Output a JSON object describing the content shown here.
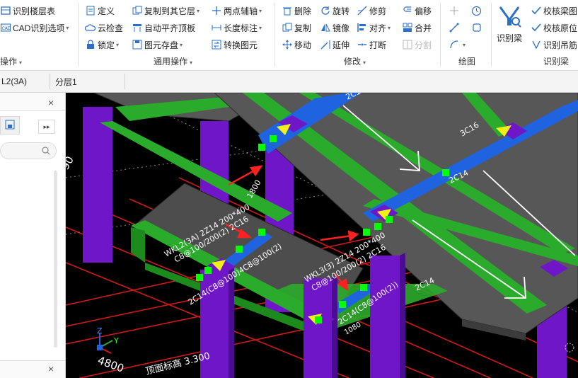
{
  "ribbon": {
    "col1": {
      "floor": "识别楼层表",
      "cad_options": "CAD识别选项",
      "group": "操作"
    },
    "col2": {
      "define": "定义",
      "cloud_check": "云检查",
      "lock": "锁定"
    },
    "col3": {
      "copy_to_floor": "复制到其它层",
      "auto_level": "自动平齐顶板",
      "save_elem": "图元存盘",
      "group": "通用操作"
    },
    "col4": {
      "two_point_axis": "两点辅轴",
      "length_label": "长度标注",
      "convert_elem": "转换图元"
    },
    "col5": {
      "delete": "删除",
      "copy": "复制",
      "move": "移动"
    },
    "col6": {
      "rotate": "旋转",
      "mirror": "镜像",
      "extend": "延伸"
    },
    "col7": {
      "trim": "修剪",
      "align": "对齐",
      "break": "打断",
      "group": "修改"
    },
    "col8": {
      "offset": "偏移",
      "merge": "合并",
      "split": "分割"
    },
    "draw": {
      "group": "绘图"
    },
    "recognize": {
      "identify_beam": "识别梁",
      "check_beam_drawing": "校核梁图",
      "check_origin": "校核原位",
      "identify_hanger": "识别吊筋",
      "group": "识别梁"
    }
  },
  "selectbar": {
    "element": "L2(3A)",
    "layer": "分层1"
  },
  "leftpanel": {
    "close": "×",
    "expand": "▸▸",
    "close_bottom": "×",
    "marker": "1"
  },
  "canvas": {
    "labels": {
      "wkl2": "WKL2(3A) 2Z14 200*400",
      "wkl2b": "C8@100/200(2) 2C16",
      "wkl2c": "2C14(C8@100)4C8@100(2)",
      "wkl3": "WKL3(3) 2Z14 200*400",
      "wkl3b": "C8@100/200(2) 2C16",
      "wkl3c": "2C14(C8@100(2))",
      "r2c14a": "2C14",
      "r3c16": "3C16",
      "r2c14b": "2C14",
      "r2c1": "2C1",
      "dim1800": "1800",
      "dim4800": "4800",
      "dim1080": "1080",
      "dim90": "90",
      "elev": "顶面标高 3.300",
      "axis_z": "Z",
      "axis_y": "Y"
    }
  },
  "colors": {
    "column": "#6f16c9",
    "beam_green": "#2bab2b",
    "beam_blue": "#1f63e0",
    "slab": "#575757",
    "grid_red": "#d01818",
    "marker_green": "#00ff00",
    "marker_yellow": "#f2ee18"
  }
}
